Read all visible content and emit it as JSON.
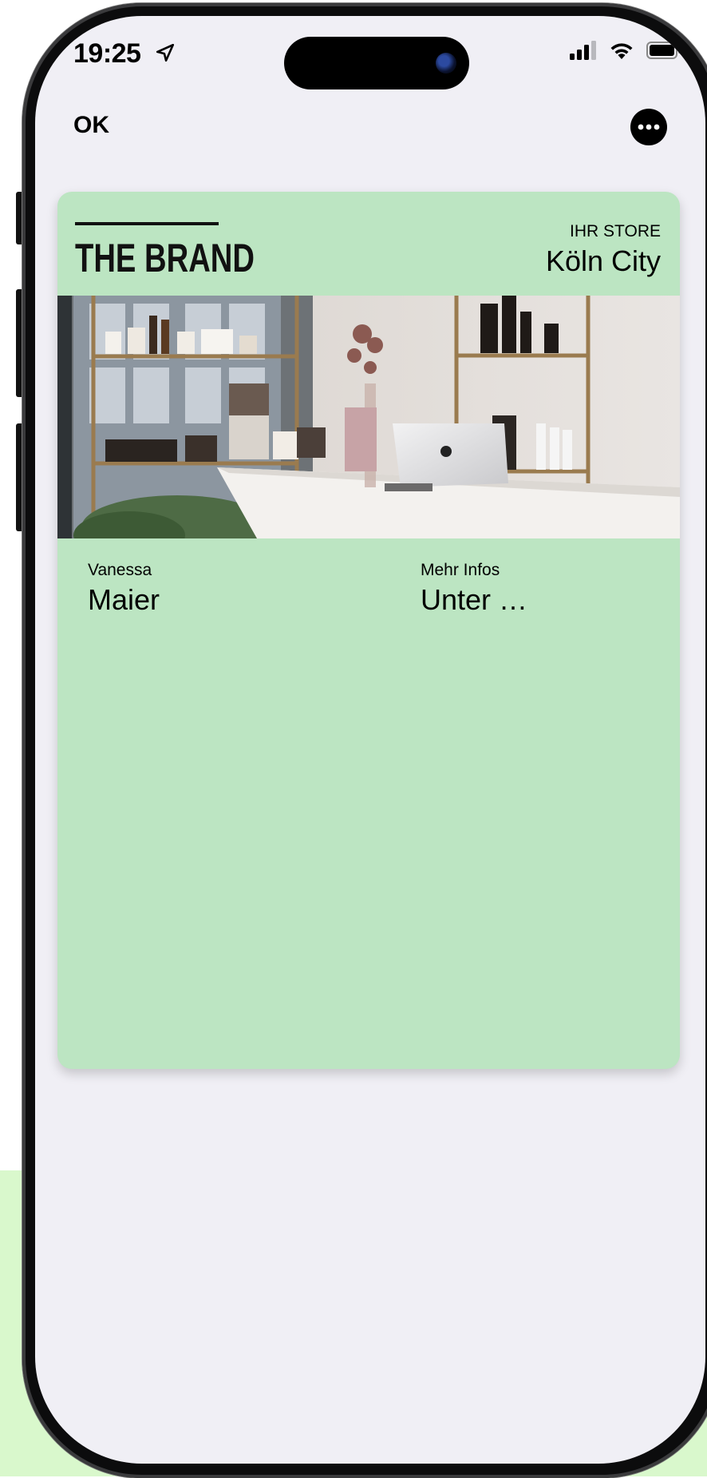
{
  "status_bar": {
    "time": "19:25"
  },
  "nav": {
    "ok_label": "OK"
  },
  "card": {
    "brand": "THE BRAND",
    "store_label": "IHR STORE",
    "store_name": "Köln City",
    "fields": [
      {
        "label": "Vanessa",
        "value": "Maier"
      },
      {
        "label": "Mehr Infos",
        "value": "Unter …"
      }
    ]
  },
  "colors": {
    "card_bg": "#bce5c2",
    "screen_bg": "#f0eff5",
    "backdrop_green": "#d9f8cc"
  },
  "icons": [
    "location-arrow-icon",
    "signal-icon",
    "wifi-icon",
    "battery-icon",
    "more-options-icon"
  ]
}
